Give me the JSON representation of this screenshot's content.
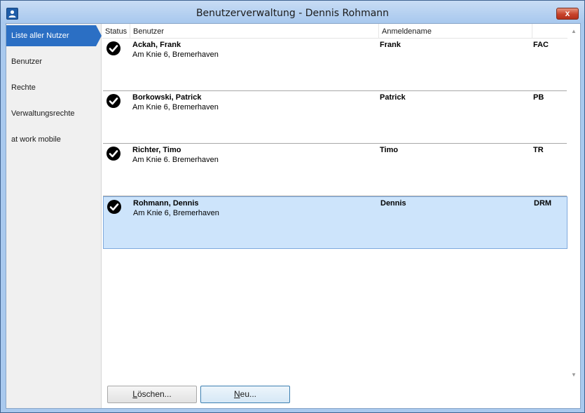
{
  "window": {
    "title": "Benutzerverwaltung - Dennis Rohmann",
    "close_label": "x"
  },
  "sidebar": {
    "items": [
      {
        "label": "Liste aller Nutzer",
        "active": true
      },
      {
        "label": "Benutzer",
        "active": false
      },
      {
        "label": "Rechte",
        "active": false
      },
      {
        "label": "Verwaltungsrechte",
        "active": false
      },
      {
        "label": "at work mobile",
        "active": false
      }
    ]
  },
  "table": {
    "columns": [
      "Status",
      "Benutzer",
      "Anmeldename",
      ""
    ],
    "rows": [
      {
        "status_icon": "check-circle-icon",
        "name": "Ackah, Frank",
        "address": "Am Knie 6, Bremerhaven",
        "login": "Frank",
        "code": "FAC",
        "selected": false
      },
      {
        "status_icon": "check-circle-icon",
        "name": "Borkowski, Patrick",
        "address": "Am Knie 6, Bremerhaven",
        "login": "Patrick",
        "code": "PB",
        "selected": false
      },
      {
        "status_icon": "check-circle-icon",
        "name": "Richter, Timo",
        "address": "Am Knie 6. Bremerhaven",
        "login": "Timo",
        "code": "TR",
        "selected": false
      },
      {
        "status_icon": "check-circle-icon",
        "name": "Rohmann, Dennis",
        "address": "Am Knie 6, Bremerhaven",
        "login": "Dennis",
        "code": "DRM",
        "selected": true
      }
    ]
  },
  "buttons": {
    "delete": {
      "mnemonic": "L",
      "rest": "öschen..."
    },
    "new": {
      "mnemonic": "N",
      "rest": "eu..."
    }
  },
  "colors": {
    "accent": "#2b6fc4",
    "selection": "#cde4fb",
    "window_frame": "#a9c9ee"
  }
}
